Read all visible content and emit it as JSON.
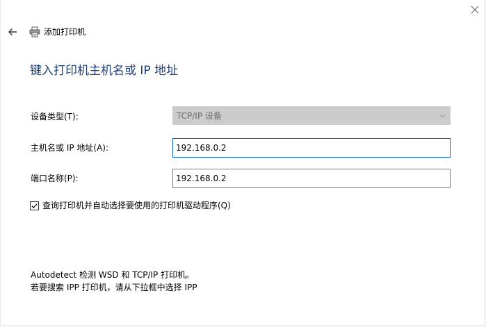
{
  "window": {
    "title": "添加打印机"
  },
  "page": {
    "heading": "键入打印机主机名或 IP 地址"
  },
  "form": {
    "device_type": {
      "label": "设备类型(T):",
      "value": "TCP/IP 设备",
      "disabled": true
    },
    "hostname": {
      "label": "主机名或 IP 地址(A):",
      "value": "192.168.0.2"
    },
    "port_name": {
      "label": "端口名称(P):",
      "value": "192.168.0.2"
    },
    "query_printer": {
      "label": "查询打印机并自动选择要使用的打印机驱动程序(Q)",
      "checked": true
    }
  },
  "info": {
    "line1": "Autodetect 检测 WSD 和 TCP/IP 打印机。",
    "line2": "若要搜索 IPP 打印机，请从下拉框中选择 IPP"
  },
  "icons": {
    "back": "back-arrow-icon",
    "printer": "printer-icon",
    "close": "close-icon",
    "chevron": "chevron-down-icon",
    "check": "checkmark-icon"
  },
  "colors": {
    "heading": "#1f3f7a",
    "focus_border": "#0a5fc8",
    "disabled_bg": "#cccccc"
  }
}
